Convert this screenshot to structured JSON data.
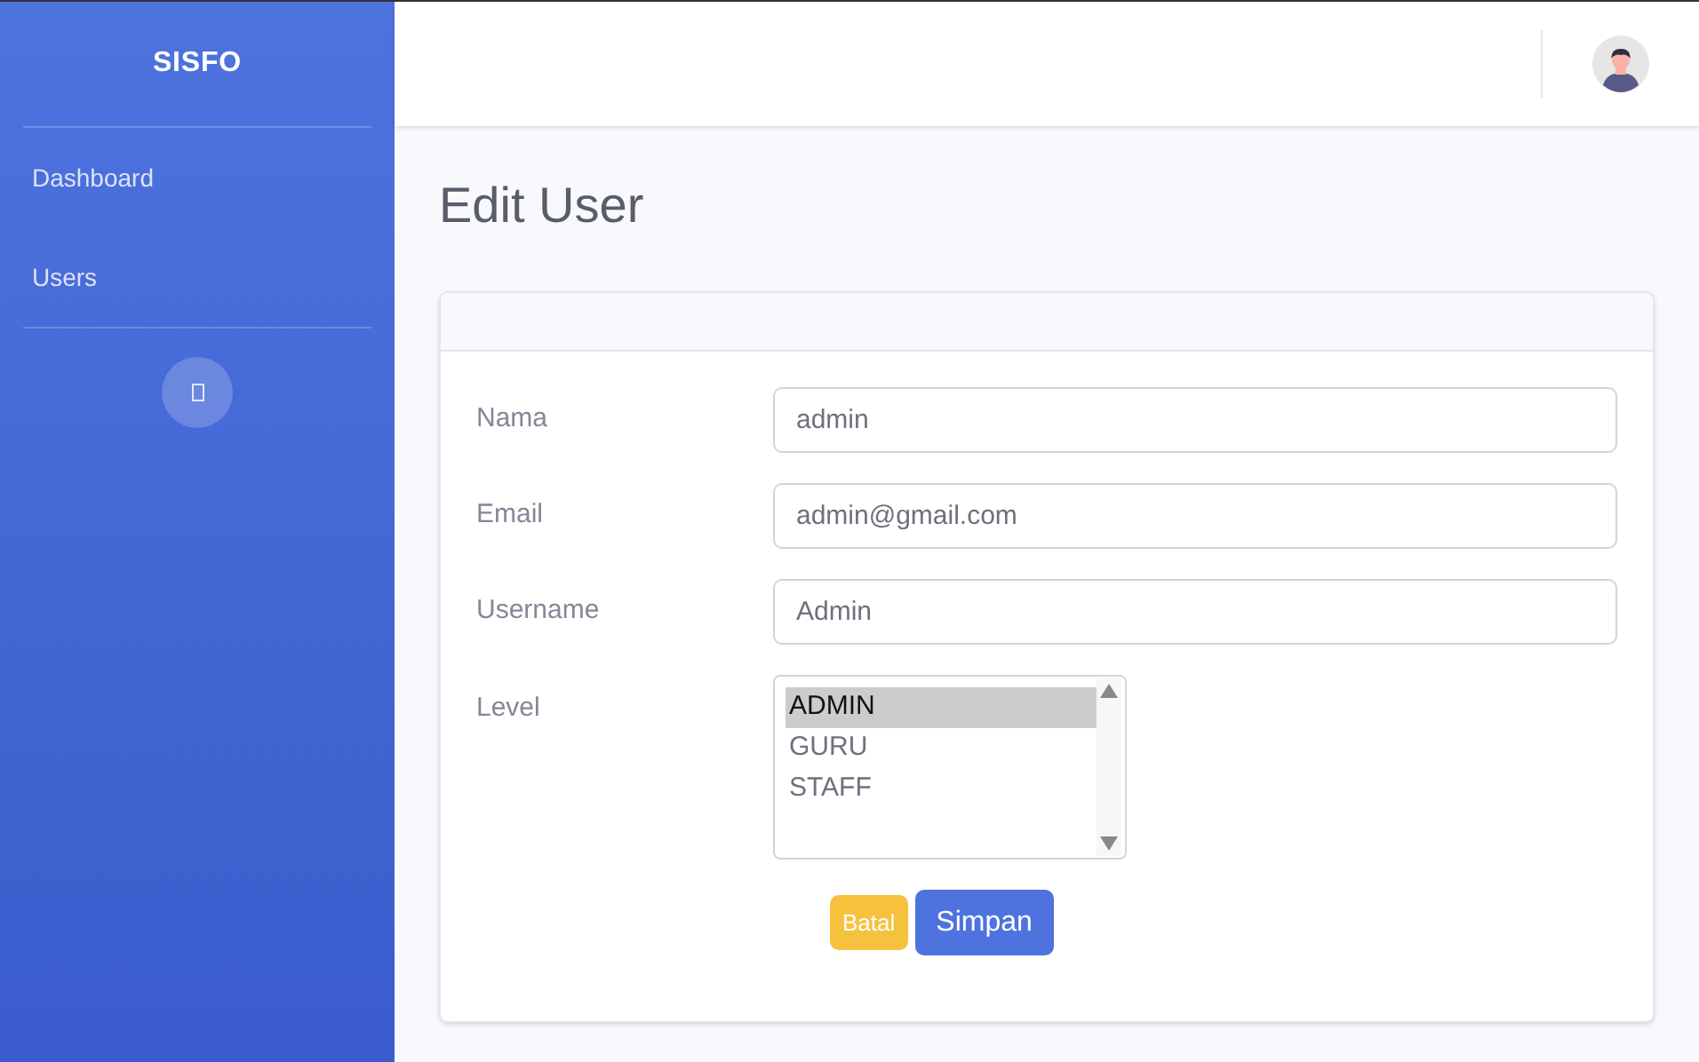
{
  "sidebar": {
    "brand": "SISFO",
    "items": [
      {
        "label": "Dashboard"
      },
      {
        "label": "Users"
      }
    ]
  },
  "page_title": "Edit User",
  "form": {
    "fields": [
      {
        "label": "Nama",
        "value": "admin"
      },
      {
        "label": "Email",
        "value": "admin@gmail.com"
      },
      {
        "label": "Username",
        "value": "Admin"
      }
    ],
    "level": {
      "label": "Level",
      "options": [
        {
          "label": "ADMIN",
          "selected": true
        },
        {
          "label": "GURU",
          "selected": false
        },
        {
          "label": "STAFF",
          "selected": false
        }
      ]
    },
    "buttons": [
      {
        "label": "Batal",
        "kind": "cancel"
      },
      {
        "label": "Simpan",
        "kind": "save"
      }
    ]
  }
}
